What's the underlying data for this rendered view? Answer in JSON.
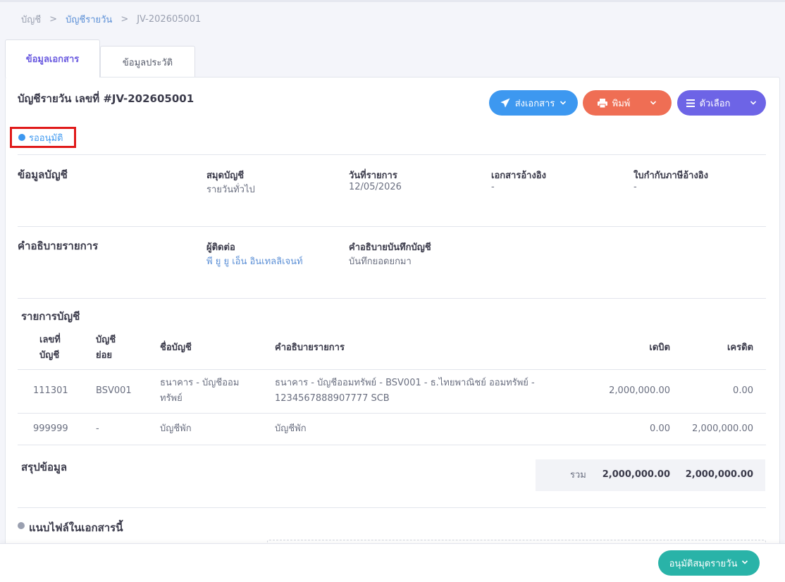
{
  "breadcrumb": {
    "root": "บัญชี",
    "section": "บัญชีรายวัน",
    "current": "JV-202605001"
  },
  "tabs": [
    {
      "label": "ข้อมูลเอกสาร",
      "active": true
    },
    {
      "label": "ข้อมูลประวัติ",
      "active": false
    }
  ],
  "document": {
    "title": "บัญชีรายวัน เลขที่ #JV-202605001",
    "status": "รออนุมัติ",
    "status_color": "#3d98f0"
  },
  "actions": {
    "send_label": "ส่งเอกสาร",
    "print_label": "พิมพ์",
    "options_label": "ตัวเลือก",
    "send_icon": "paper-plane-icon",
    "print_icon": "printer-icon",
    "options_icon": "menu-icon",
    "send_color": "#3d98f0",
    "print_color": "#ef6e54",
    "options_color": "#6d64e6"
  },
  "account_info": {
    "title": "ข้อมูลบัญชี",
    "journal_label": "สมุดบัญชี",
    "journal_value": "รายวันทั่วไป",
    "date_label": "วันที่รายการ",
    "date_value": "12/05/2026",
    "ref_doc_label": "เอกสารอ้างอิง",
    "ref_doc_value": "-",
    "tax_invoice_label": "ใบกำกับภาษีอ้างอิง",
    "tax_invoice_value": "-"
  },
  "description_info": {
    "title": "คำอธิบายรายการ",
    "contact_label": "ผู้ติดต่อ",
    "contact_value": "พี ยู ยู เอ็น อินเทลลิเจนท์",
    "note_label": "คำอธิบายบันทึกบัญชี",
    "note_value": "บันทึกยอดยกมา"
  },
  "entries": {
    "title": "รายการบัญชี",
    "headers": {
      "account_no_line1": "เลขที่",
      "account_no_line2": "บัญชี",
      "sub_account_line1": "บัญชี",
      "sub_account_line2": "ย่อย",
      "account_name": "ชื่อบัญชี",
      "description": "คำอธิบายรายการ",
      "debit": "เดบิต",
      "credit": "เครดิต"
    },
    "rows": [
      {
        "account_no": "111301",
        "sub_account": "BSV001",
        "name_line1": "ธนาคาร - บัญชีออม",
        "name_line2": "ทรัพย์",
        "desc_line1": "ธนาคาร - บัญชีออมทรัพย์ - BSV001 - ธ.ไทยพาณิชย์ ออมทรัพย์ -",
        "desc_line2": "1234567888907777 SCB",
        "debit": "2,000,000.00",
        "credit": "0.00"
      },
      {
        "account_no": "999999",
        "sub_account": "-",
        "name_line1": "บัญชีพัก",
        "name_line2": "",
        "desc_line1": "บัญชีพัก",
        "desc_line2": "",
        "debit": "0.00",
        "credit": "2,000,000.00"
      }
    ]
  },
  "summary": {
    "title": "สรุปข้อมูล",
    "total_label": "รวม",
    "total_debit": "2,000,000.00",
    "total_credit": "2,000,000.00"
  },
  "attachments": {
    "title": "แนบไฟล์ในเอกสารนี้"
  },
  "footer": {
    "approve_label": "อนุมัติสมุดรายวัน",
    "approve_color": "#29b3a8"
  }
}
